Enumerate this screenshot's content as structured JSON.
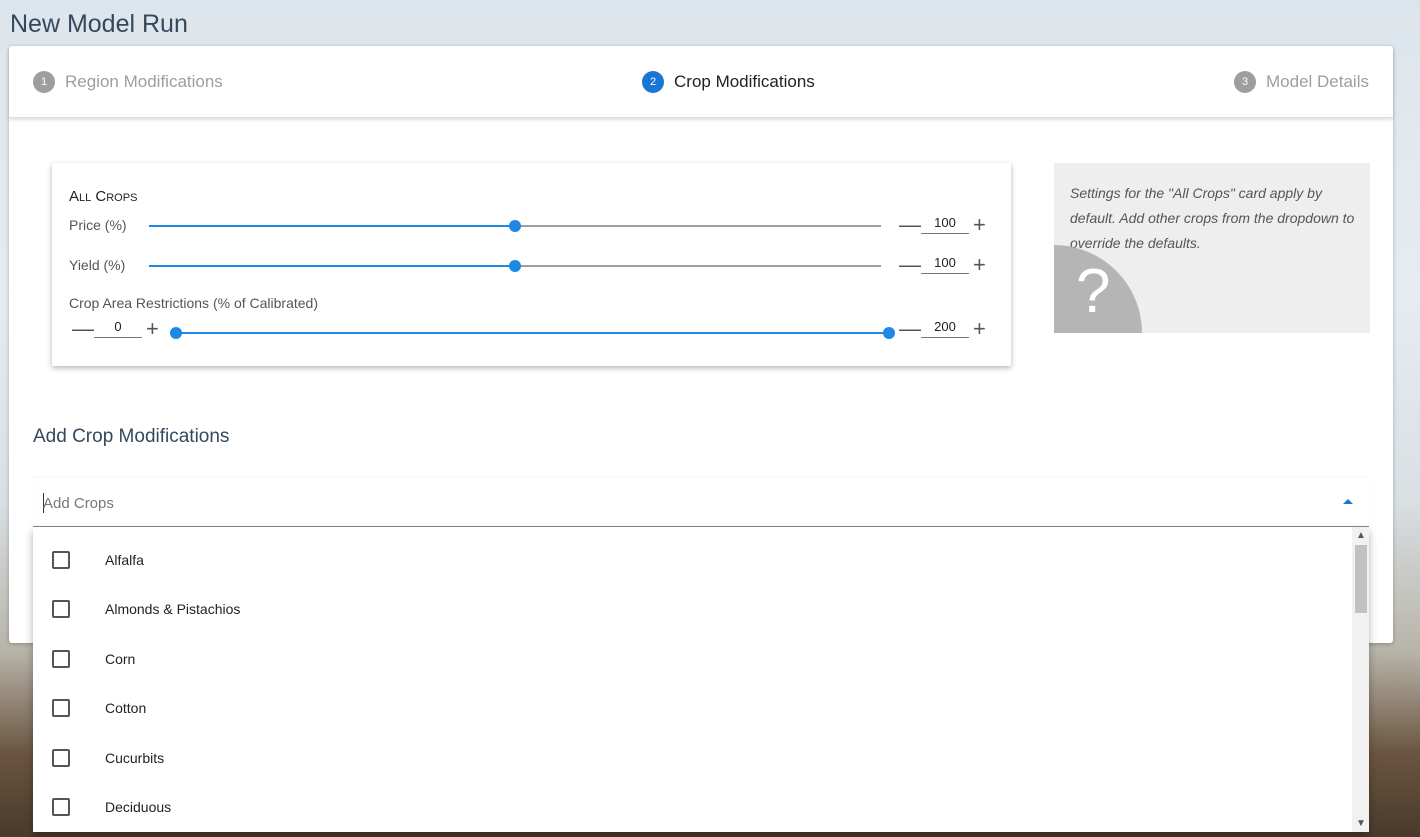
{
  "page": {
    "title": "New Model Run"
  },
  "stepper": {
    "steps": [
      {
        "number": "1",
        "label": "Region Modifications",
        "active": false
      },
      {
        "number": "2",
        "label": "Crop Modifications",
        "active": true
      },
      {
        "number": "3",
        "label": "Model Details",
        "active": false
      }
    ]
  },
  "all_crops": {
    "title": "All Crops",
    "price": {
      "label": "Price (%)",
      "value": "100",
      "slider_fraction": 0.5
    },
    "yield": {
      "label": "Yield (%)",
      "value": "100",
      "slider_fraction": 0.5
    },
    "area": {
      "label": "Crop Area Restrictions (% of Calibrated)",
      "min_value": "0",
      "max_value": "200"
    },
    "minus_symbol": "—",
    "plus_symbol": "+"
  },
  "info": {
    "text": "Settings for the \"All Crops\" card apply by default. Add other crops from the dropdown to override the defaults.",
    "help_symbol": "?"
  },
  "add_crops": {
    "title": "Add Crop Modifications",
    "placeholder": "Add Crops",
    "options": [
      "Alfalfa",
      "Almonds & Pistachios",
      "Corn",
      "Cotton",
      "Cucurbits",
      "Deciduous"
    ]
  },
  "colors": {
    "accent": "#1e88e5",
    "step_active": "#1976d2",
    "step_inactive": "#9e9e9e"
  },
  "icons": {
    "dropdown_arrow": "arrow-up-icon",
    "checkbox": "checkbox-unchecked-icon"
  }
}
